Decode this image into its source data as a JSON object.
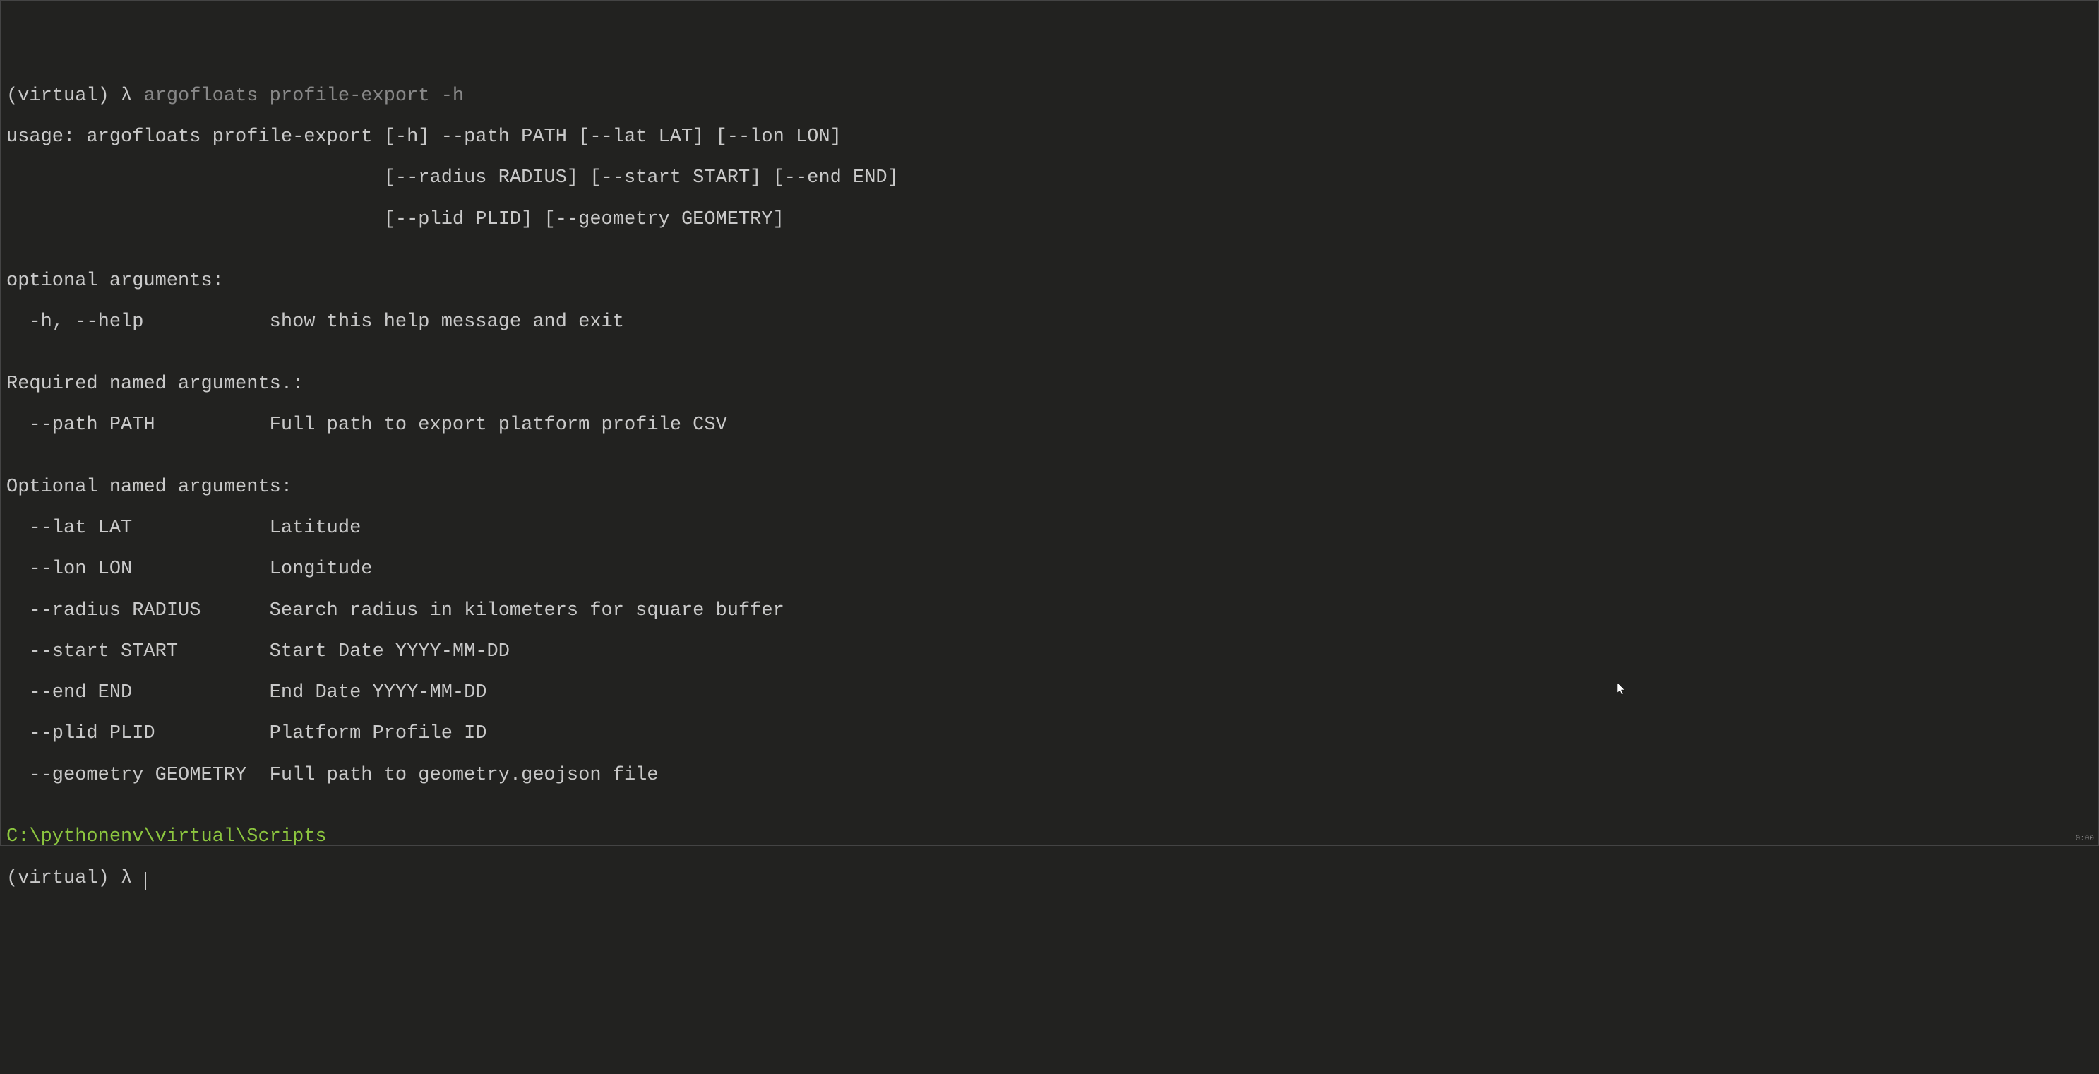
{
  "prompt1": {
    "env": "(virtual) ",
    "lambda": "λ ",
    "command": "argofloats profile-export -h"
  },
  "output": {
    "usage_l1": "usage: argofloats profile-export [-h] --path PATH [--lat LAT] [--lon LON]",
    "usage_l2": "                                 [--radius RADIUS] [--start START] [--end END]",
    "usage_l3": "                                 [--plid PLID] [--geometry GEOMETRY]",
    "blank": "",
    "opt_header": "optional arguments:",
    "opt_help": "  -h, --help           show this help message and exit",
    "req_header": "Required named arguments.:",
    "req_path": "  --path PATH          Full path to export platform profile CSV",
    "optn_header": "Optional named arguments:",
    "optn_lat": "  --lat LAT            Latitude",
    "optn_lon": "  --lon LON            Longitude",
    "optn_radius": "  --radius RADIUS      Search radius in kilometers for square buffer",
    "optn_start": "  --start START        Start Date YYYY-MM-DD",
    "optn_end": "  --end END            End Date YYYY-MM-DD",
    "optn_plid": "  --plid PLID          Platform Profile ID",
    "optn_geom": "  --geometry GEOMETRY  Full path to geometry.geojson file"
  },
  "cwd": "C:\\pythonenv\\virtual\\Scripts",
  "prompt2": {
    "env": "(virtual) ",
    "lambda": "λ "
  },
  "statusbar": "0:00"
}
